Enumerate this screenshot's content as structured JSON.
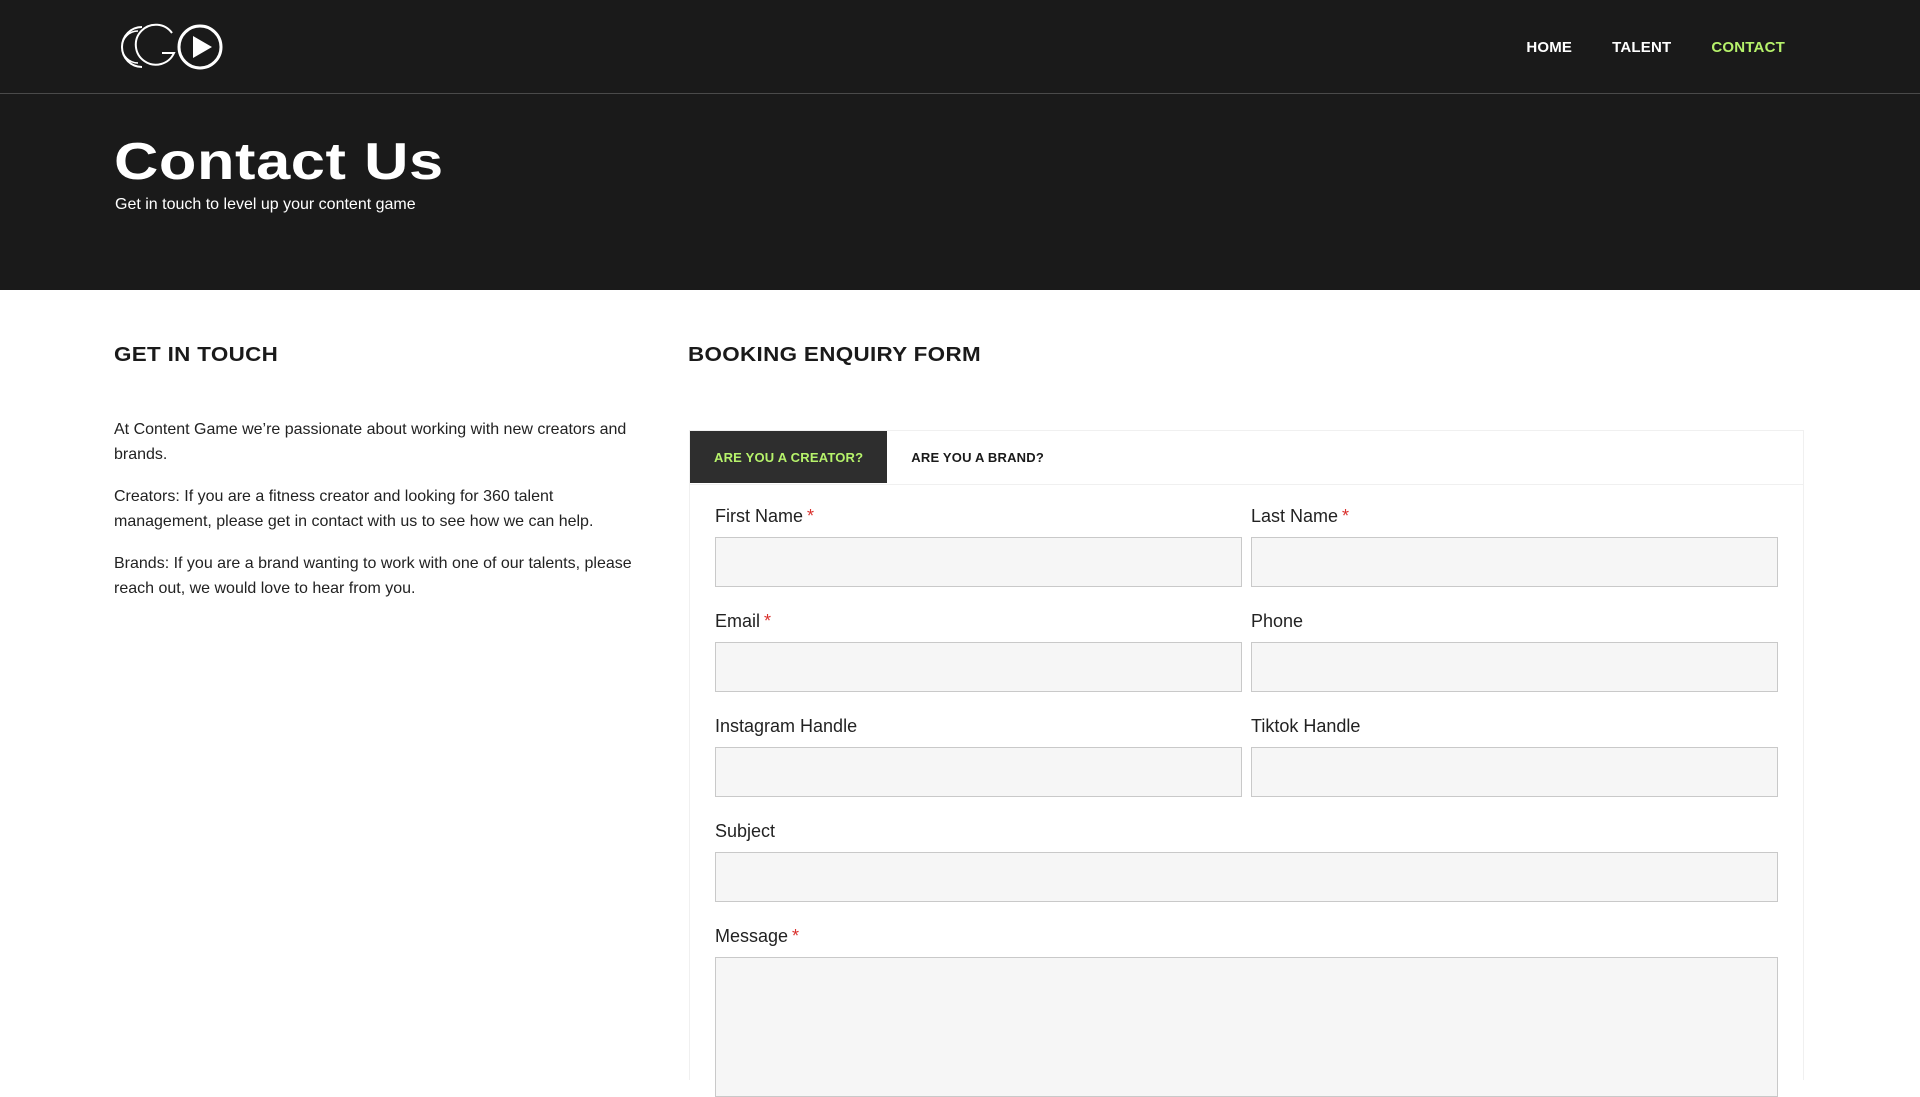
{
  "brand": {
    "logo_icon": "content-game-logo-icon",
    "accent_color": "#b6f26b",
    "dark_color": "#1a1a1a"
  },
  "nav": {
    "items": [
      {
        "label": "HOME",
        "active": false
      },
      {
        "label": "TALENT",
        "active": false
      },
      {
        "label": "CONTACT",
        "active": true
      }
    ]
  },
  "hero": {
    "title": "Contact Us",
    "subtitle": "Get in touch to level up your content game"
  },
  "get_in_touch": {
    "heading": "GET IN TOUCH",
    "paragraphs": [
      "At Content Game we’re passionate about working with new creators and brands.",
      "Creators: If you are a fitness creator and looking for 360 talent management, please get in contact with us to see how we can help.",
      "Brands: If you are a brand wanting to work with one of our talents, please reach out, we would love to hear from you."
    ]
  },
  "form": {
    "heading": "BOOKING ENQUIRY FORM",
    "tabs": [
      {
        "label": "ARE YOU A CREATOR?",
        "active": true
      },
      {
        "label": "ARE YOU A BRAND?",
        "active": false
      }
    ],
    "required_marker": "*",
    "fields": {
      "first_name": {
        "label": "First Name",
        "value": ""
      },
      "last_name": {
        "label": "Last Name",
        "value": ""
      },
      "email": {
        "label": "Email",
        "value": ""
      },
      "phone": {
        "label": "Phone",
        "value": ""
      },
      "instagram": {
        "label": "Instagram Handle",
        "value": ""
      },
      "tiktok": {
        "label": "Tiktok Handle",
        "value": ""
      },
      "subject": {
        "label": "Subject",
        "value": ""
      },
      "message": {
        "label": "Message",
        "value": ""
      }
    }
  }
}
